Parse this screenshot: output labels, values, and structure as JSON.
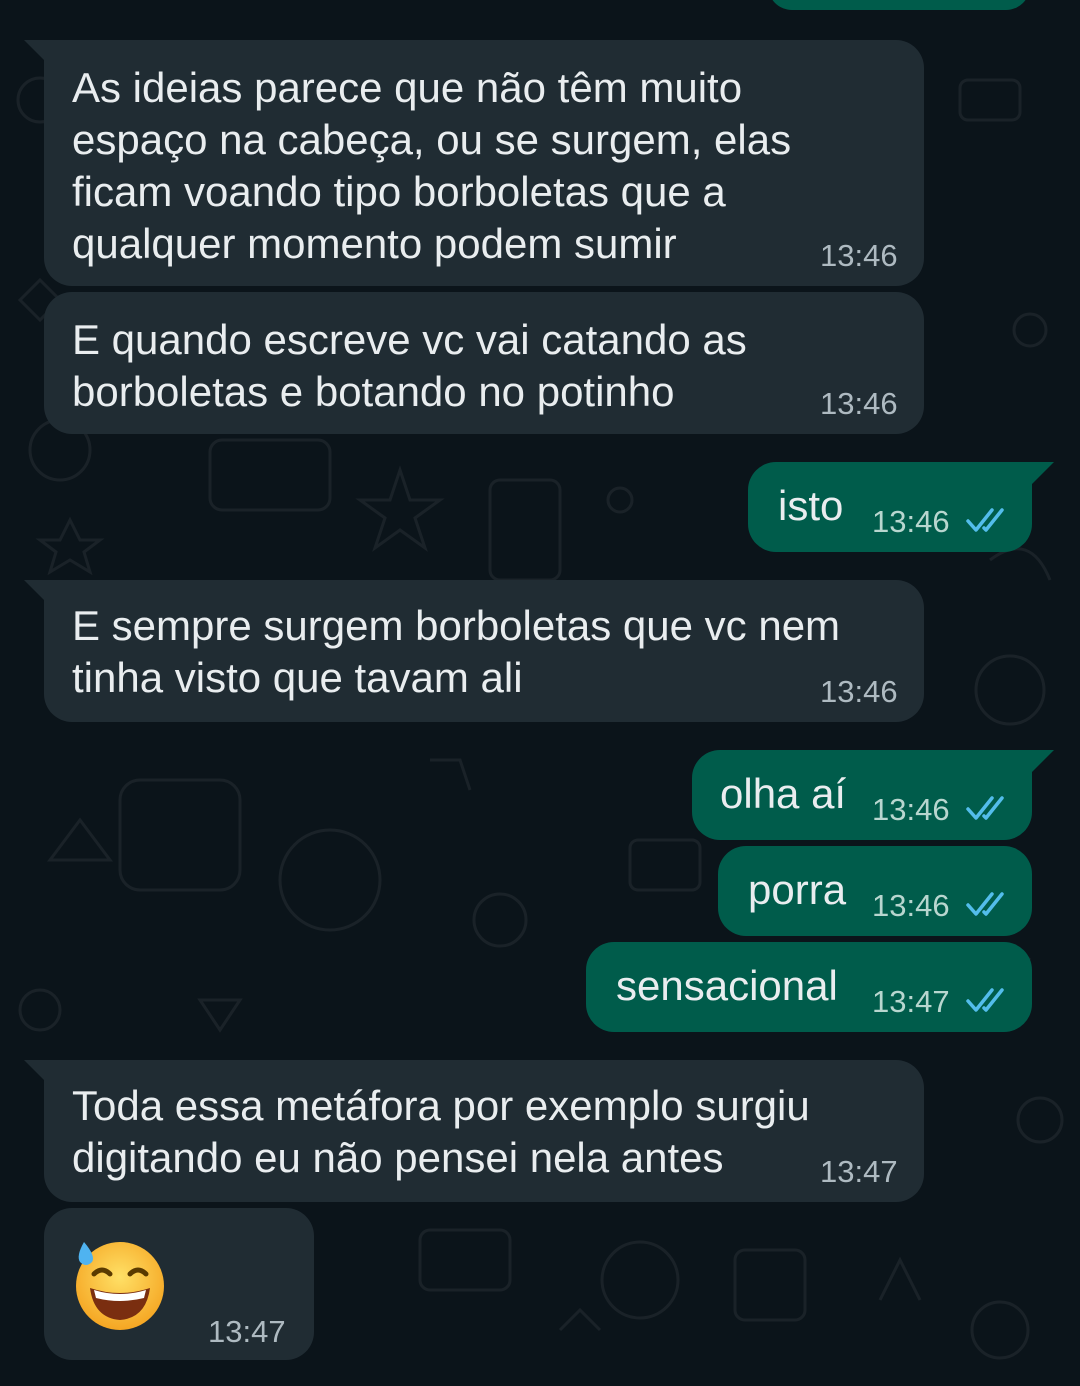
{
  "colors": {
    "background": "#0b141a",
    "incoming_bubble": "#202c33",
    "outgoing_bubble": "#005c4b",
    "text": "#e9edef",
    "timestamp": "#aebac1",
    "read_ticks": "#53bdeb"
  },
  "messages": [
    {
      "direction": "incoming",
      "text": "As ideias parece que não têm muito\nespaço na cabeça, ou se surgem, elas\nficam voando tipo borboletas que a\nqualquer momento podem sumir",
      "time": "13:46"
    },
    {
      "direction": "incoming",
      "text": "E quando escreve vc vai catando as\nborboletas e botando no potinho",
      "time": "13:46"
    },
    {
      "direction": "outgoing",
      "text": "isto",
      "time": "13:46",
      "status": "read"
    },
    {
      "direction": "incoming",
      "text": "E sempre surgem borboletas que vc nem\ntinha visto que tavam ali",
      "time": "13:46"
    },
    {
      "direction": "outgoing",
      "text": "olha aí",
      "time": "13:46",
      "status": "read"
    },
    {
      "direction": "outgoing",
      "text": "porra",
      "time": "13:46",
      "status": "read"
    },
    {
      "direction": "outgoing",
      "text": "sensacional",
      "time": "13:47",
      "status": "read"
    },
    {
      "direction": "incoming",
      "text": "Toda essa metáfora por exemplo surgiu\ndigitando eu não pensei nela antes",
      "time": "13:47"
    },
    {
      "direction": "incoming",
      "emoji": "grinning-face-with-sweat",
      "time": "13:47"
    }
  ]
}
